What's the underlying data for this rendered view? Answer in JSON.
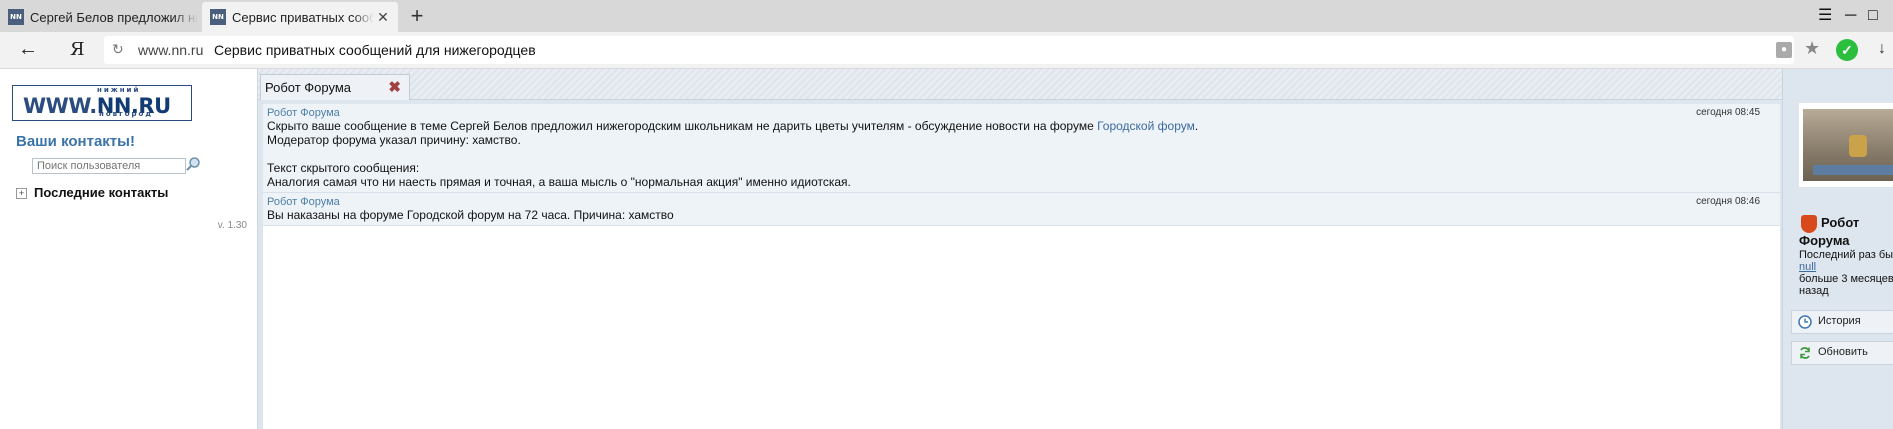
{
  "browser": {
    "tabs": [
      {
        "title": "Сергей Белов предложил нижегородским школьникам",
        "favicon": "NN",
        "close": "✕",
        "active": false
      },
      {
        "title": "Сервис приватных сообщений",
        "favicon": "NN",
        "close": "✕",
        "active": true
      }
    ],
    "new_tab": "+",
    "address": {
      "domain": "www.nn.ru",
      "title": "Сервис приватных сообщений для нижегородцев"
    },
    "yandex_button": "Я"
  },
  "sidebar": {
    "logo": {
      "top": "нижний",
      "main_prefix": "WWW.",
      "main_accent": "NN.RU",
      "bottom": "новгород"
    },
    "contacts_title": "Ваши контакты!",
    "search_placeholder": "Поиск пользователя",
    "recent_contacts": "Последние контакты",
    "version": "v. 1.30"
  },
  "chat": {
    "tab_label": "Робот Форума",
    "messages": [
      {
        "author": "Робот Форума",
        "time": "сегодня 08:45",
        "line1_prefix": "Скрыто ваше сообщение в теме Сергей Белов предложил нижегородским школьникам не дарить цветы учителям - обсуждение новости на форуме ",
        "line1_link": "Городской форум",
        "line1_suffix": ".",
        "line2": "Модератор форума указал причину: хамство.",
        "line3": "Текст скрытого сообщения:",
        "line4": "Аналогия самая что ни наесть прямая и точная, а ваша мысль о \"нормальная акция\" именно идиотская."
      },
      {
        "author": "Робот Форума",
        "time": "сегодня 08:46",
        "text": "Вы наказаны на форуме Городской форум на 72 часа. Причина: хамство"
      }
    ]
  },
  "profile": {
    "name_line1": "Робот",
    "name_line2": "Форума",
    "status_line1": "Последний раз был",
    "status_link": "null",
    "status_line2": "больше 3 месяцев",
    "status_line3": "назад",
    "buttons": {
      "history": "История",
      "refresh": "Обновить"
    }
  }
}
